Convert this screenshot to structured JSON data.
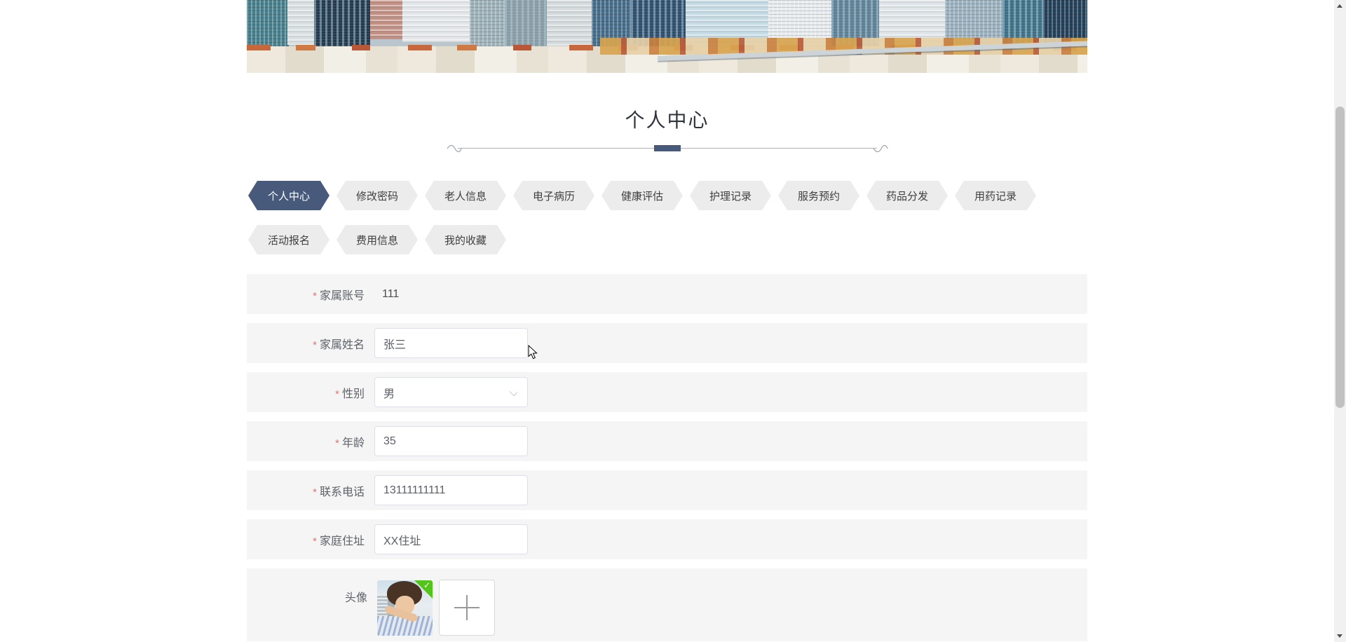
{
  "title": "个人中心",
  "tabs": {
    "row1": [
      "个人中心",
      "修改密码",
      "老人信息",
      "电子病历",
      "健康评估",
      "护理记录",
      "服务预约",
      "药品分发",
      "用药记录"
    ],
    "row2": [
      "活动报名",
      "费用信息",
      "我的收藏"
    ],
    "active": "个人中心"
  },
  "form": {
    "required_mark": "*",
    "rows": [
      {
        "key": "family-account",
        "label": "家属账号",
        "required": true,
        "control": "static",
        "value": "111"
      },
      {
        "key": "family-name",
        "label": "家属姓名",
        "required": true,
        "control": "input",
        "value": "张三"
      },
      {
        "key": "gender",
        "label": "性别",
        "required": true,
        "control": "select",
        "value": "男"
      },
      {
        "key": "age",
        "label": "年龄",
        "required": true,
        "control": "input",
        "value": "35"
      },
      {
        "key": "phone",
        "label": "联系电话",
        "required": true,
        "control": "input",
        "value": "13111111111"
      },
      {
        "key": "address",
        "label": "家庭住址",
        "required": true,
        "control": "input",
        "value": "XX住址"
      },
      {
        "key": "avatar",
        "label": "头像",
        "required": false,
        "control": "avatar",
        "badge": "✓"
      }
    ]
  },
  "icons": {
    "select_arrow": "chevron-down-icon",
    "upload": "plus-icon",
    "avatar_status": "check-icon",
    "scrollbar": [
      "scroll-up-icon",
      "scroll-down-icon"
    ]
  },
  "colors": {
    "accent": "#475a7c",
    "tab_inactive_bg": "#ececec",
    "row_bg": "#f5f5f5",
    "required": "#f56c6c",
    "input_border": "#dcdfe6",
    "success_badge": "#52c41a",
    "text": "#5f6368"
  }
}
